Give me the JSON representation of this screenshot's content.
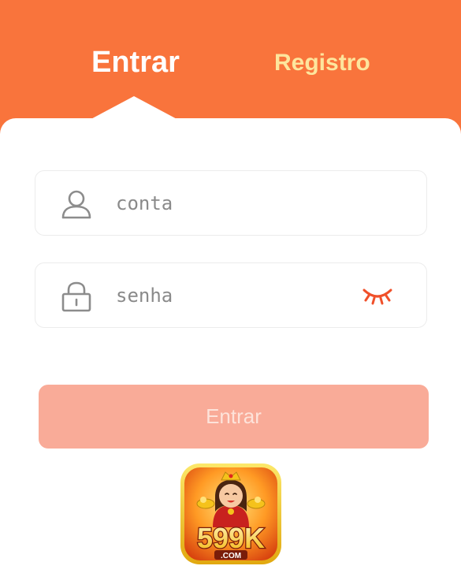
{
  "tabs": {
    "login_label": "Entrar",
    "register_label": "Registro",
    "active": "login"
  },
  "form": {
    "account_placeholder": "conta",
    "account_value": "",
    "password_placeholder": "senha",
    "password_value": "",
    "submit_label": "Entrar"
  },
  "logo": {
    "text_main": "599K",
    "text_sub": ".COM"
  },
  "icons": {
    "account": "user-icon",
    "password": "lock-icon",
    "visibility": "eye-closed-icon"
  },
  "colors": {
    "brand_orange": "#f9743c",
    "register_tab": "#fde59d",
    "submit_disabled": "#f9ab98",
    "eye_icon": "#f0502a"
  }
}
